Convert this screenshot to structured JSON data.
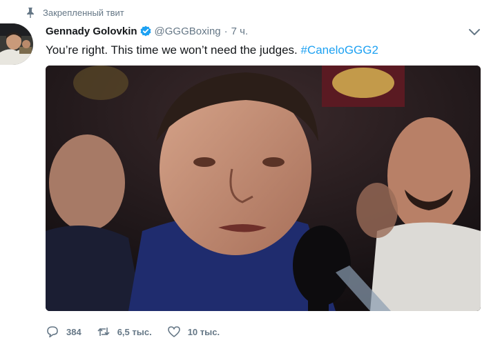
{
  "pinned": {
    "label": "Закрепленный твит",
    "icon": "pin-icon"
  },
  "author": {
    "name": "Gennady Golovkin",
    "handle": "@GGGBoxing",
    "separator": "·",
    "time": "7 ч.",
    "verified_icon": "verified-badge-icon"
  },
  "tweet": {
    "text": "You’re right. This time we won’t need the judges. ",
    "hashtag": "#CaneloGGG2"
  },
  "actions": {
    "reply": {
      "icon": "reply-icon",
      "count": "384"
    },
    "retweet": {
      "icon": "retweet-icon",
      "count": "6,5 тыс."
    },
    "like": {
      "icon": "heart-icon",
      "count": "10 тыс."
    }
  },
  "menu": {
    "icon": "chevron-down-icon"
  },
  "colors": {
    "accent": "#1da1f2",
    "text": "#14171a",
    "secondary": "#657786"
  }
}
